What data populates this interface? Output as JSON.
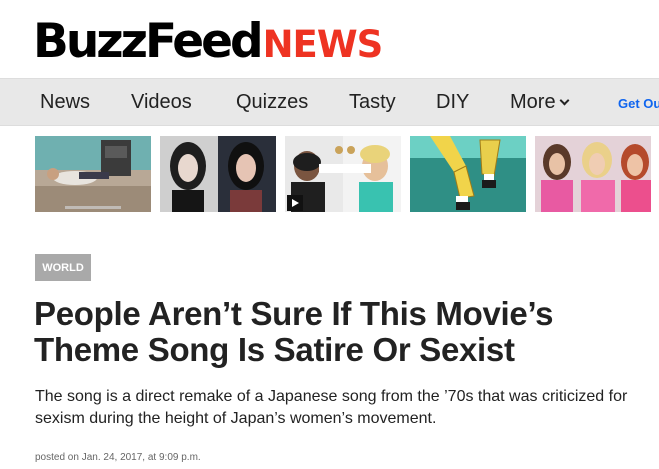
{
  "brand": {
    "buzz": "BuzzFeed",
    "news": "NEWS",
    "accent": "#ee3322"
  },
  "nav": {
    "items": [
      "News",
      "Videos",
      "Quizzes",
      "Tasty",
      "DIY"
    ],
    "more": "More",
    "cta": "Get Ou"
  },
  "thumbnails": [
    {
      "subject": "person lying on floor of room"
    },
    {
      "subject": "two portraits of dark-haired woman"
    },
    {
      "subject": "two people with shared glasses",
      "icon": "play-icon"
    },
    {
      "subject": "cartoon character legs"
    },
    {
      "subject": "group of women in pink"
    }
  ],
  "article": {
    "section": "WORLD",
    "headline": "People Aren’t Sure If This Movie’s Theme Song Is Satire Or Sexist",
    "dek": "The song is a direct remake of a Japanese song from the ’70s that was criticized for sexism during the height of Japan’s women’s movement.",
    "posted": "posted on Jan. 24, 2017, at 9:09 p.m."
  }
}
